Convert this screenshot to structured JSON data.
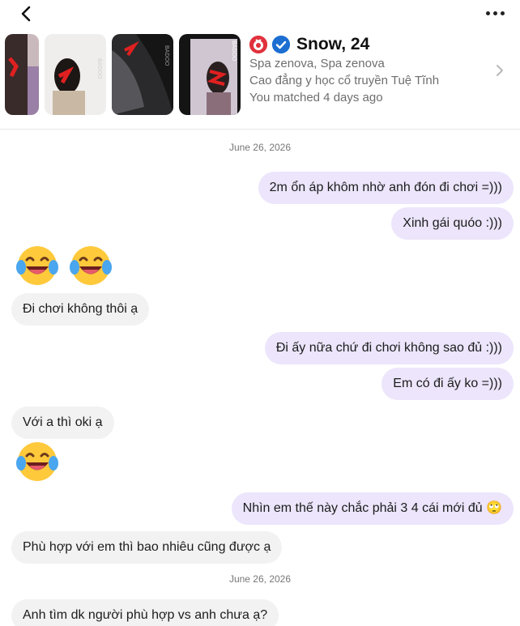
{
  "profile": {
    "name": "Snow, 24",
    "location": "Spa zenova, Spa zenova",
    "school": "Cao đẳng y học cổ truyền Tuệ Tĩnh",
    "matched": "You matched 4 days ago",
    "photo_watermark": "BADOO"
  },
  "icons": {
    "back": "chevron-left-icon",
    "more": "more-horizontal-icon",
    "verified": "verified-check-icon",
    "crush": "crush-badge-icon",
    "open_profile": "chevron-right-icon",
    "emoji": "laughing-tears-emoji"
  },
  "colors": {
    "outgoing_bubble": "#ece5fb",
    "incoming_bubble": "#f2f2f2",
    "verified": "#1c6fd1",
    "crush": "#e0313c"
  },
  "dates": [
    "June 26, 2026",
    "June 26, 2026"
  ],
  "messages": [
    {
      "text": "2m ổn áp khôm nhờ anh đón đi chơi =)))",
      "dir": "out"
    },
    {
      "text": "Xinh gái quóo :)))",
      "dir": "out"
    },
    {
      "text": "Đi chơi không thôi ạ",
      "dir": "in"
    },
    {
      "text": "Đi ấy nữa chứ đi chơi không sao đủ :)))",
      "dir": "out"
    },
    {
      "text": "Em có đi ấy ko =)))",
      "dir": "out"
    },
    {
      "text": "Với a thì oki ạ",
      "dir": "in"
    },
    {
      "text": "Nhìn em thế này chắc phải 3 4 cái mới đủ 🙄",
      "dir": "out"
    },
    {
      "text": "Phù hợp với em thì bao nhiêu cũng được ạ",
      "dir": "in"
    },
    {
      "text": "Anh tìm dk người phù hợp vs anh chưa ạ?",
      "dir": "in"
    }
  ]
}
